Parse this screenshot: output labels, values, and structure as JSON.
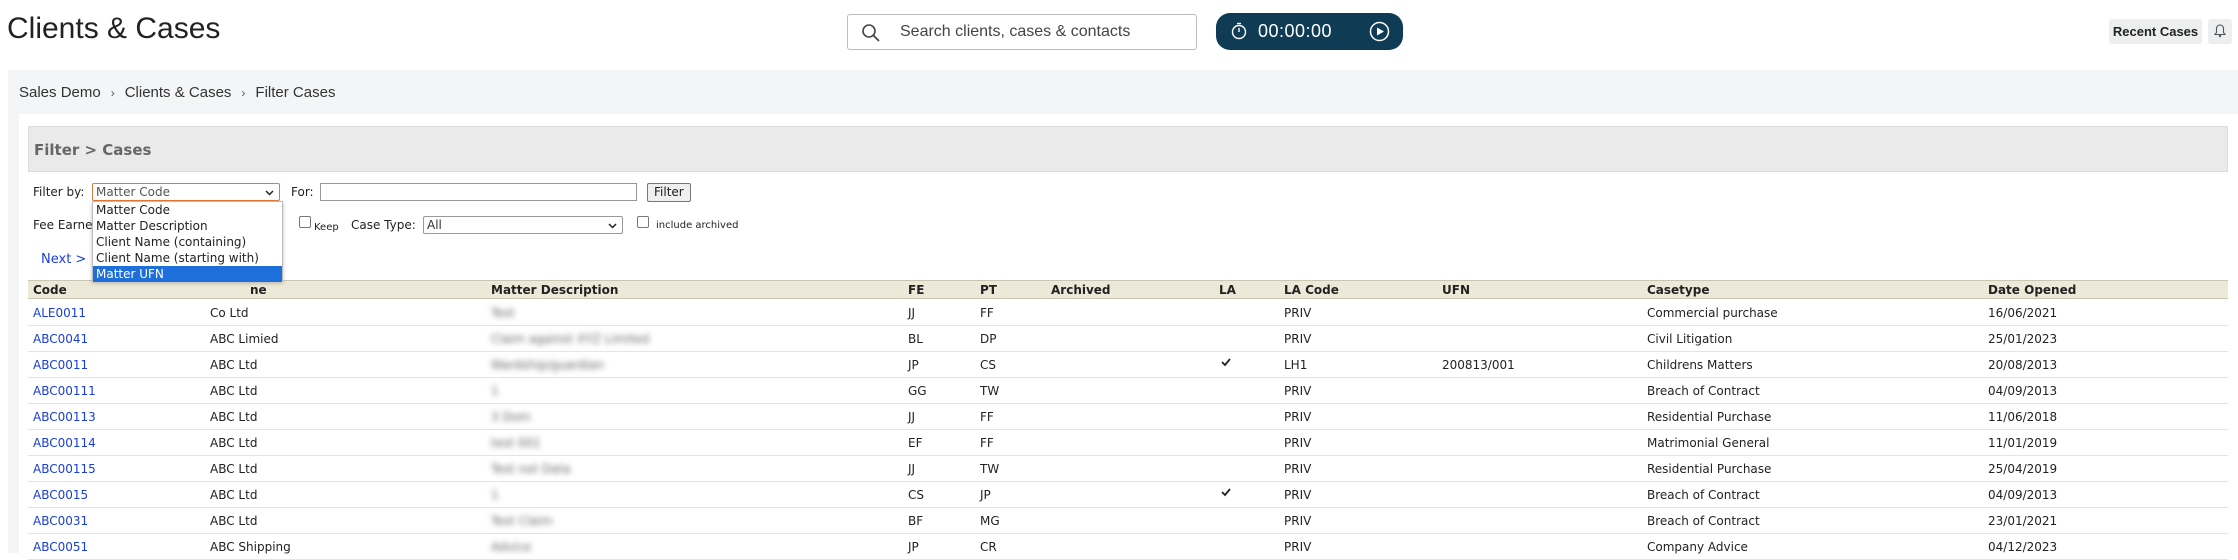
{
  "app": {
    "title": "Clients & Cases",
    "search_placeholder": "Search clients, cases & contacts",
    "timer": "00:00:00",
    "recent_label": "Recent Cases",
    "accent": "#0f3b55"
  },
  "breadcrumb": {
    "items": [
      "Sales Demo",
      "Clients & Cases",
      "Filter Cases"
    ],
    "separator": "›"
  },
  "filter": {
    "header": "Filter > Cases",
    "filter_by_label": "Filter by:",
    "filter_by_value": "Matter Code",
    "for_label": "For:",
    "for_value": "",
    "filter_button": "Filter",
    "fee_earner_label": "Fee Earner:",
    "keep_label": "Keep",
    "case_type_label": "Case Type:",
    "case_type_value": "All",
    "include_archived_label": "include archived",
    "next_label": "Next >"
  },
  "dropdown": {
    "options": [
      "Matter Code",
      "Matter Description",
      "Client Name (containing)",
      "Client Name (starting with)",
      "Matter UFN"
    ],
    "selected": "Matter UFN"
  },
  "table": {
    "headers": {
      "code": "Code",
      "name": "ne",
      "desc": "Matter Description",
      "fe": "FE",
      "pt": "PT",
      "archived": "Archived",
      "la": "LA",
      "lacode": "LA Code",
      "ufn": "UFN",
      "casetype": "Casetype",
      "opened": "Date Opened"
    },
    "rows": [
      {
        "code": "ALE0011",
        "name": "Co Ltd",
        "desc": "Test",
        "fe": "JJ",
        "pt": "FF",
        "la": false,
        "lacode": "PRIV",
        "ufn": "",
        "casetype": "Commercial purchase",
        "opened": "16/06/2021"
      },
      {
        "code": "ABC0041",
        "name": "ABC Limied",
        "desc": "Claim against XYZ Limited",
        "fe": "BL",
        "pt": "DP",
        "la": false,
        "lacode": "PRIV",
        "ufn": "",
        "casetype": "Civil Litigation",
        "opened": "25/01/2023"
      },
      {
        "code": "ABC0011",
        "name": "ABC Ltd",
        "desc": "Wardship/guardian",
        "fe": "JP",
        "pt": "CS",
        "la": true,
        "lacode": "LH1",
        "ufn": "200813/001",
        "casetype": "Childrens Matters",
        "opened": "20/08/2013"
      },
      {
        "code": "ABC00111",
        "name": "ABC Ltd",
        "desc": "1",
        "fe": "GG",
        "pt": "TW",
        "la": false,
        "lacode": "PRIV",
        "ufn": "",
        "casetype": "Breach of Contract",
        "opened": "04/09/2013"
      },
      {
        "code": "ABC00113",
        "name": "ABC Ltd",
        "desc": "3 Dom",
        "fe": "JJ",
        "pt": "FF",
        "la": false,
        "lacode": "PRIV",
        "ufn": "",
        "casetype": "Residential Purchase",
        "opened": "11/06/2018"
      },
      {
        "code": "ABC00114",
        "name": "ABC Ltd",
        "desc": "test 001",
        "fe": "EF",
        "pt": "FF",
        "la": false,
        "lacode": "PRIV",
        "ufn": "",
        "casetype": "Matrimonial General",
        "opened": "11/01/2019"
      },
      {
        "code": "ABC00115",
        "name": "ABC Ltd",
        "desc": "Test not Data",
        "fe": "JJ",
        "pt": "TW",
        "la": false,
        "lacode": "PRIV",
        "ufn": "",
        "casetype": "Residential Purchase",
        "opened": "25/04/2019"
      },
      {
        "code": "ABC0015",
        "name": "ABC Ltd",
        "desc": "1",
        "fe": "CS",
        "pt": "JP",
        "la": true,
        "lacode": "PRIV",
        "ufn": "",
        "casetype": "Breach of Contract",
        "opened": "04/09/2013"
      },
      {
        "code": "ABC0031",
        "name": "ABC Ltd",
        "desc": "Test Claim",
        "fe": "BF",
        "pt": "MG",
        "la": false,
        "lacode": "PRIV",
        "ufn": "",
        "casetype": "Breach of Contract",
        "opened": "23/01/2021"
      },
      {
        "code": "ABC0051",
        "name": "ABC Shipping",
        "desc": "Advice",
        "fe": "JP",
        "pt": "CR",
        "la": false,
        "lacode": "PRIV",
        "ufn": "",
        "casetype": "Company Advice",
        "opened": "04/12/2023"
      }
    ]
  }
}
